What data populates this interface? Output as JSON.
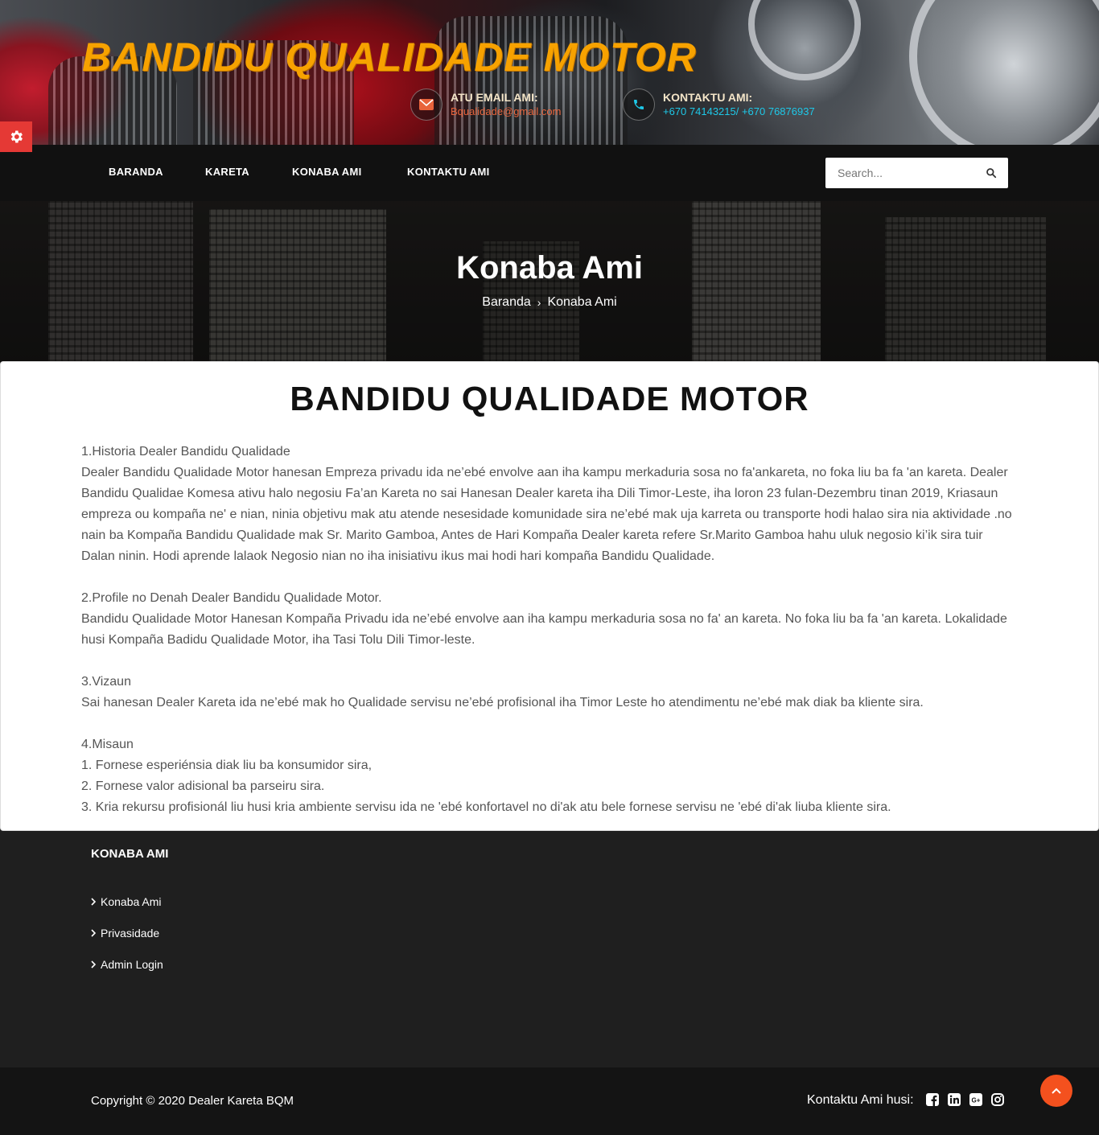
{
  "header": {
    "site_title": "BANDIDU QUALIDADE MOTOR",
    "email": {
      "label": "ATU EMAIL AMI:",
      "value": "Bqualidade@gmail.com",
      "icon": "envelope-icon",
      "color": "#e8643c"
    },
    "phone": {
      "label": "KONTAKTU AMI:",
      "value": "+670 74143215/ +670 76876937",
      "icon": "phone-icon",
      "color": "#1ec8e8"
    },
    "title_color": "#f7a200"
  },
  "settings": {
    "icon": "gear-icon",
    "color": "#e53935"
  },
  "nav": {
    "items": [
      {
        "label": "BARANDA"
      },
      {
        "label": "KARETA"
      },
      {
        "label": "KONABA AMI"
      },
      {
        "label": "KONTAKTU AMI"
      }
    ],
    "search_placeholder": "Search..."
  },
  "hero": {
    "title": "Konaba Ami",
    "breadcrumb": [
      "Baranda",
      "Konaba Ami"
    ]
  },
  "content": {
    "heading": "BANDIDU QUALIDADE MOTOR",
    "sections": [
      {
        "title": "1.Historia Dealer Bandidu Qualidade",
        "lines": [
          "Dealer Bandidu Qualidade Motor hanesan Empreza privadu ida ne’ebé envolve aan iha kampu merkaduria sosa no fa'ankareta, no foka liu ba fa 'an kareta. Dealer Bandidu Qualidae Komesa ativu halo negosiu Fa’an Kareta no sai Hanesan Dealer kareta iha Dili Timor-Leste, iha loron 23 fulan-Dezembru tinan 2019, Kriasaun empreza ou kompaña ne' e nian, ninia objetivu mak atu atende nesesidade komunidade sira ne’ebé mak uja karreta ou transporte hodi halao sira nia aktividade .no nain ba Kompaña Bandidu Qualidade mak Sr. Marito Gamboa, Antes de Hari Kompaña Dealer kareta refere Sr.Marito Gamboa hahu uluk negosio ki’ik sira tuir Dalan ninin. Hodi aprende lalaok Negosio nian no iha inisiativu ikus mai hodi hari kompaña Bandidu Qualidade."
        ]
      },
      {
        "title": "2.Profile no Denah Dealer Bandidu Qualidade Motor.",
        "lines": [
          "Bandidu Qualidade Motor Hanesan Kompaña Privadu ida ne’ebé envolve aan iha kampu merkaduria sosa no fa' an kareta. No foka liu ba fa 'an kareta. Lokalidade husi Kompaña Badidu Qualidade Motor, iha Tasi Tolu Dili Timor-leste."
        ]
      },
      {
        "title": "3.Vizaun",
        "lines": [
          "Sai hanesan Dealer Kareta ida ne’ebé mak ho Qualidade servisu ne’ebé profisional iha Timor Leste ho atendimentu ne’ebé mak diak ba kliente sira."
        ]
      },
      {
        "title": "4.Misaun",
        "lines": [
          "1. Fornese esperiénsia diak liu ba konsumidor sira,",
          "2. Fornese valor adisional ba parseiru sira.",
          "3. Kria rekursu profisionál liu husi kria ambiente servisu ida ne 'ebé konfortavel no di'ak atu bele fornese servisu ne 'ebé di'ak liuba kliente sira."
        ]
      }
    ]
  },
  "footer": {
    "title": "KONABA AMI",
    "links": [
      "Konaba Ami",
      "Privasidade",
      "Admin Login"
    ],
    "copyright": "Copyright © 2020 Dealer Kareta BQM",
    "social_label": "Kontaktu Ami husi:",
    "social_icons": [
      "facebook-icon",
      "linkedin-icon",
      "google-plus-icon",
      "instagram-icon"
    ],
    "to_top_color": "#f4511e"
  }
}
